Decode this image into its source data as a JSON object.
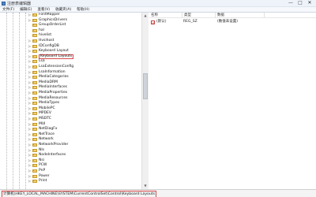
{
  "window": {
    "title": "注册表编辑器",
    "controls": [
      "—",
      "□",
      "✕"
    ]
  },
  "menu": [
    "文件(F)",
    "编辑(E)",
    "查看(V)",
    "收藏夹(A)",
    "帮助(H)"
  ],
  "tree": {
    "items": [
      {
        "label": "FontMapper",
        "expander": "▷"
      },
      {
        "label": "GraphicsDrivers",
        "expander": "▷"
      },
      {
        "label": "GroupOrderList",
        "expander": ""
      },
      {
        "label": "hal",
        "expander": ""
      },
      {
        "label": "hivelist",
        "expander": ""
      },
      {
        "label": "Hvsihost",
        "expander": "▷"
      },
      {
        "label": "IDConfigDB",
        "expander": "▷"
      },
      {
        "label": "Keyboard Layout",
        "expander": "▷"
      },
      {
        "label": "Keyboard Layouts",
        "expander": "▷",
        "selected": true
      },
      {
        "label": "Lsa",
        "expander": "▷"
      },
      {
        "label": "LsaExtensionConfig",
        "expander": "▷"
      },
      {
        "label": "LsaInformation",
        "expander": "▷"
      },
      {
        "label": "MediaCategories",
        "expander": "▷"
      },
      {
        "label": "MediaDRM",
        "expander": "▷"
      },
      {
        "label": "MediaInterfaces",
        "expander": "▷"
      },
      {
        "label": "MediaProperties",
        "expander": "▷"
      },
      {
        "label": "MediaResources",
        "expander": "▷"
      },
      {
        "label": "MediaTypes",
        "expander": "▷"
      },
      {
        "label": "MobilePC",
        "expander": "▷"
      },
      {
        "label": "MPDEV",
        "expander": "▷"
      },
      {
        "label": "MSDTC",
        "expander": "▷"
      },
      {
        "label": "MUI",
        "expander": "▷"
      },
      {
        "label": "NetDiagFx",
        "expander": "▷"
      },
      {
        "label": "NetTrace",
        "expander": "▷"
      },
      {
        "label": "Network",
        "expander": "▷"
      },
      {
        "label": "NetworkProvider",
        "expander": "▷"
      },
      {
        "label": "Nls",
        "expander": "▷"
      },
      {
        "label": "NodeInterfaces",
        "expander": "▷"
      },
      {
        "label": "Nsi",
        "expander": "▷"
      },
      {
        "label": "PCW",
        "expander": "▷"
      },
      {
        "label": "PnP",
        "expander": "▷"
      },
      {
        "label": "Power",
        "expander": "▷"
      },
      {
        "label": "Print",
        "expander": "▷"
      }
    ]
  },
  "values_pane": {
    "columns": [
      "名称",
      "类型",
      "数据"
    ],
    "rows": [
      {
        "icon_text": "ab",
        "name": "(默认)",
        "type": "REG_SZ",
        "data": "(数值未设置)"
      }
    ]
  },
  "status": {
    "path": "计算机\\HKEY_LOCAL_MACHINE\\SYSTEM\\CurrentControlSet\\Control\\Keyboard Layouts"
  },
  "scrollbar": {
    "up_arrow": "▲",
    "down_arrow": "▼"
  },
  "colors": {
    "highlight_border": "#d64a4a",
    "folder": "#f3cf67"
  }
}
